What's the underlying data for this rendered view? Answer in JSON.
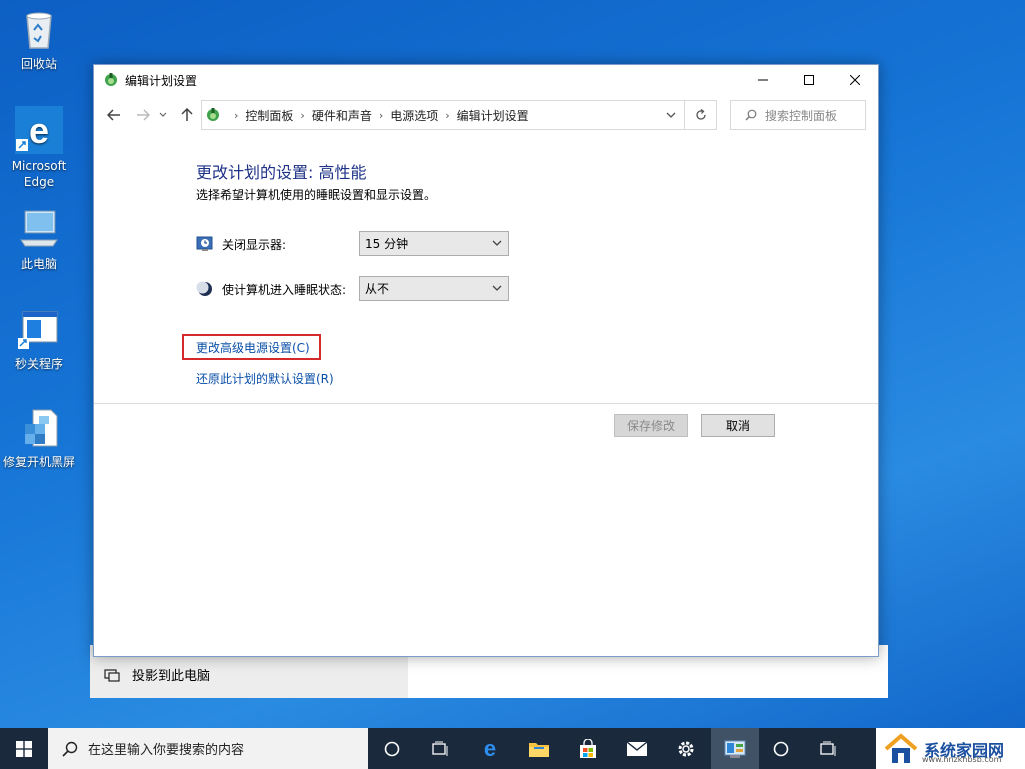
{
  "desktop": {
    "icons": [
      {
        "label": "回收站"
      },
      {
        "label": "Microsoft Edge"
      },
      {
        "label": "此电脑"
      },
      {
        "label": "秒关程序"
      },
      {
        "label": "修复开机黑屏"
      }
    ]
  },
  "background_window": {
    "item": "投影到此电脑"
  },
  "window": {
    "title": "编辑计划设置",
    "address": {
      "crumbs": [
        "控制面板",
        "硬件和声音",
        "电源选项",
        "编辑计划设置"
      ]
    },
    "search_placeholder": "搜索控制面板",
    "heading": "更改计划的设置: 高性能",
    "subtitle": "选择希望计算机使用的睡眠设置和显示设置。",
    "settings": [
      {
        "label": "关闭显示器:",
        "value": "15 分钟"
      },
      {
        "label": "使计算机进入睡眠状态:",
        "value": "从不"
      }
    ],
    "links": {
      "advanced": "更改高级电源设置(C)",
      "restore": "还原此计划的默认设置(R)"
    },
    "buttons": {
      "save": "保存修改",
      "cancel": "取消"
    }
  },
  "taskbar": {
    "search_placeholder": "在这里输入你要搜索的内容",
    "icons": [
      "cortana-icon",
      "task-view-icon",
      "edge-icon",
      "file-explorer-icon",
      "store-icon",
      "mail-icon",
      "settings-icon",
      "control-panel-icon",
      "cortana-icon",
      "task-view-icon"
    ]
  },
  "watermark": {
    "text": "系统家园网",
    "url": "www.hnzkhbsb.com"
  },
  "colors": {
    "accent": "#0a4fa8",
    "heading": "#1e3287",
    "highlight": "#d42a2a",
    "desktop": "#1675d6",
    "taskbar": "#1a2a3c"
  }
}
